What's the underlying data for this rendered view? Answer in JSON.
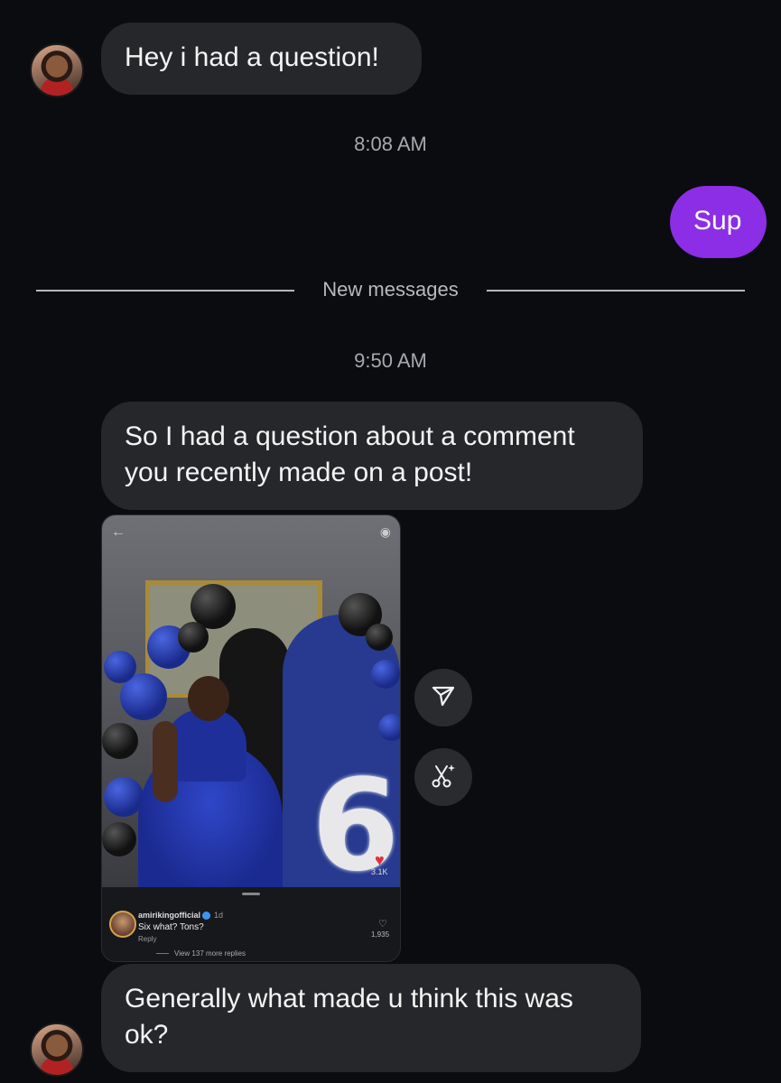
{
  "messages": {
    "first_incoming": "Hey i had a question!",
    "timestamp_1": "8:08 AM",
    "outgoing": "Sup",
    "new_messages_divider": "New messages",
    "timestamp_2": "9:50 AM",
    "second_incoming": "So I had a question about a comment you recently made on a post!",
    "third_incoming": "Generally what made u think this was ok?"
  },
  "shared_post": {
    "views": "3.1K",
    "comment": {
      "username": "amirikingofficial",
      "age": "1d",
      "text": "Six what? Tons?",
      "reply_label": "Reply",
      "likes": "1,935",
      "view_replies": "View 137 more replies"
    }
  },
  "actions": {
    "share_icon": "send-icon",
    "remix_icon": "scissors-sparkle-icon"
  },
  "colors": {
    "background": "#0b0c10",
    "incoming_bubble": "#26272b",
    "outgoing_bubble": "#8c2ee6"
  }
}
